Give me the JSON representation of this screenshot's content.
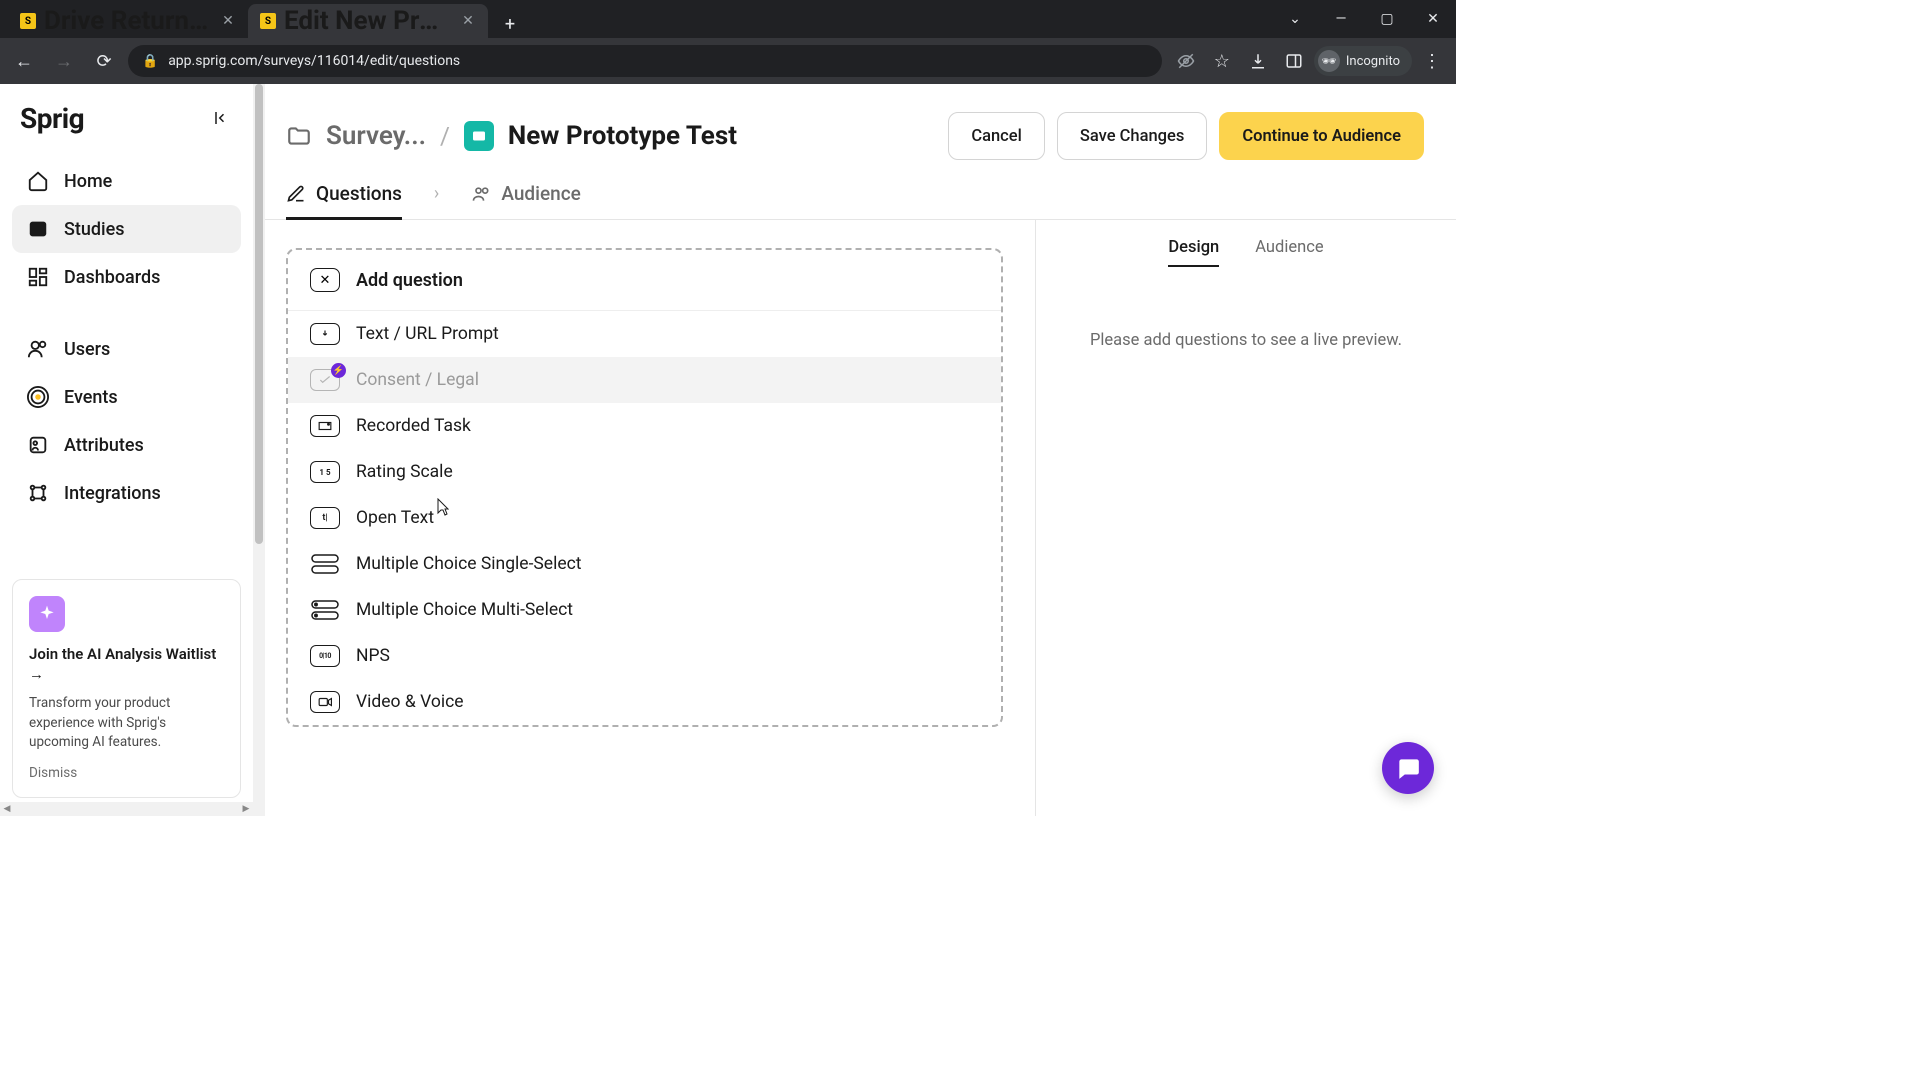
{
  "browser": {
    "tabs": [
      {
        "title": "Drive Return Visits Responses",
        "active": false
      },
      {
        "title": "Edit New Prototype Test",
        "active": true
      }
    ],
    "url": "app.sprig.com/surveys/116014/edit/questions",
    "incognito_label": "Incognito"
  },
  "sidebar": {
    "logo": "Sprig",
    "items": [
      {
        "key": "home",
        "label": "Home"
      },
      {
        "key": "studies",
        "label": "Studies",
        "active": true
      },
      {
        "key": "dashboards",
        "label": "Dashboards"
      }
    ],
    "items2": [
      {
        "key": "users",
        "label": "Users"
      },
      {
        "key": "events",
        "label": "Events"
      },
      {
        "key": "attributes",
        "label": "Attributes"
      },
      {
        "key": "integrations",
        "label": "Integrations"
      }
    ],
    "ai_card": {
      "title": "Join the AI Analysis Waitlist →",
      "body": "Transform your product experience with Sprig's upcoming AI features.",
      "dismiss": "Dismiss"
    }
  },
  "header": {
    "crumb": "Survey...",
    "title": "New Prototype Test",
    "cancel": "Cancel",
    "save": "Save Changes",
    "continue": "Continue to Audience"
  },
  "tabs": {
    "questions": "Questions",
    "audience": "Audience"
  },
  "add_panel": {
    "title": "Add question",
    "types": {
      "text_url": "Text / URL Prompt",
      "consent": "Consent / Legal",
      "recorded": "Recorded Task",
      "rating": "Rating Scale",
      "open_text": "Open Text",
      "mc_single": "Multiple Choice Single-Select",
      "mc_multi": "Multiple Choice Multi-Select",
      "nps": "NPS",
      "video": "Video & Voice"
    }
  },
  "preview": {
    "tab_design": "Design",
    "tab_audience": "Audience",
    "empty": "Please add questions to see a live preview."
  }
}
